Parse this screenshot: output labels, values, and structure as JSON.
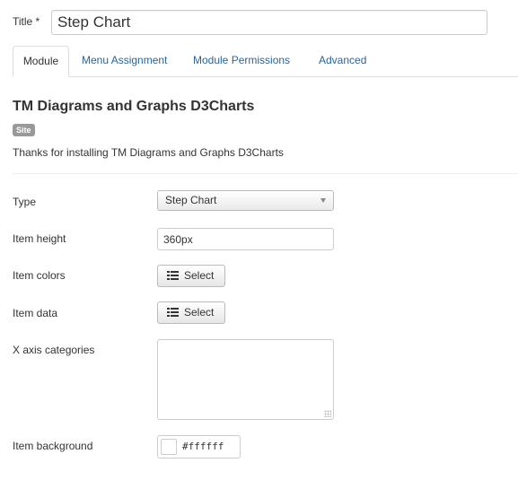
{
  "title_field": {
    "label": "Title *",
    "value": "Step Chart"
  },
  "tabs": [
    {
      "label": "Module",
      "active": true
    },
    {
      "label": "Menu Assignment",
      "active": false
    },
    {
      "label": "Module Permissions",
      "active": false
    },
    {
      "label": "Advanced",
      "active": false
    }
  ],
  "module": {
    "title": "TM Diagrams and Graphs D3Charts",
    "badge": "Site",
    "description": "Thanks for installing TM Diagrams and Graphs D3Charts"
  },
  "fields": {
    "type": {
      "label": "Type",
      "value": "Step Chart",
      "icon": "caret-down-icon"
    },
    "item_height": {
      "label": "Item height",
      "value": "360px"
    },
    "item_colors": {
      "label": "Item colors",
      "button_label": "Select",
      "icon": "list-icon"
    },
    "item_data": {
      "label": "Item data",
      "button_label": "Select",
      "icon": "list-icon"
    },
    "x_axis_categories": {
      "label": "X axis categories",
      "value": ""
    },
    "item_background": {
      "label": "Item background",
      "value": "#ffffff",
      "swatch_color": "#ffffff"
    }
  },
  "colors": {
    "link": "#2a6496",
    "badge_bg": "#999999",
    "border": "#cccccc"
  }
}
